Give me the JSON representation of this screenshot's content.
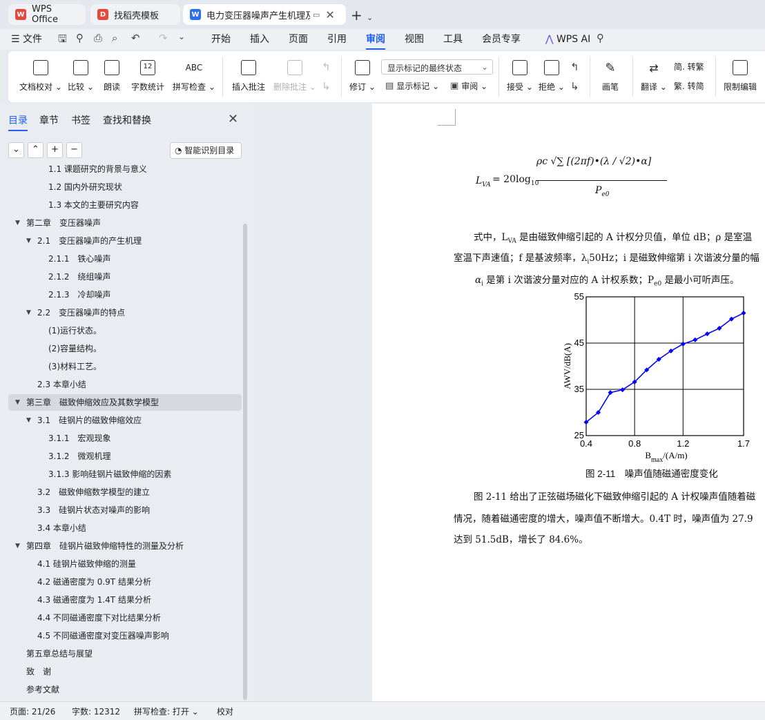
{
  "tabs": [
    {
      "label": "WPS Office",
      "logo": "W",
      "logo_color": "#e8473c"
    },
    {
      "label": "找稻壳模板",
      "logo": "D",
      "logo_color": "#e8473c"
    },
    {
      "label": "电力变压器噪声产生机理及其影",
      "logo": "W",
      "logo_color": "#2d6cf5"
    }
  ],
  "menu": {
    "file": "文件",
    "items": [
      "开始",
      "插入",
      "页面",
      "引用",
      "审阅",
      "视图",
      "工具",
      "会员专享"
    ],
    "active": "审阅",
    "ai": "WPS AI"
  },
  "ribbon": {
    "doc_check": "文档校对",
    "compare": "比较",
    "read": "朗读",
    "word_count": "字数统计",
    "spell": "拼写检查",
    "insert_comment": "插入批注",
    "delete_comment": "删除批注",
    "revise": "修订",
    "show_state": "显示标记的最终状态",
    "show_marks": "显示标记",
    "review": "审阅",
    "accept": "接受",
    "reject": "拒绝",
    "pen": "画笔",
    "translate": "翻译",
    "trad": "简. 转繁",
    "simp": "繁. 转简",
    "restrict": "限制编辑"
  },
  "sidebar": {
    "tabs": [
      "目录",
      "章节",
      "书签",
      "查找和替换"
    ],
    "smart_btn": "智能识别目录",
    "toc": [
      {
        "label": "1.1 课题研究的背景与意义",
        "level": 3
      },
      {
        "label": "1.2 国内外研究现状",
        "level": 3
      },
      {
        "label": "1.3 本文的主要研究内容",
        "level": 3
      },
      {
        "label": "第二章　变压器噪声",
        "level": 1,
        "toggle": true
      },
      {
        "label": "2.1　变压器噪声的产生机理",
        "level": 2,
        "toggle": true
      },
      {
        "label": "2.1.1　铁心噪声",
        "level": 3
      },
      {
        "label": "2.1.2　绕组噪声",
        "level": 3
      },
      {
        "label": "2.1.3　冷却噪声",
        "level": 3
      },
      {
        "label": "2.2　变压器噪声的特点",
        "level": 2,
        "toggle": true
      },
      {
        "label": "(1)运行状态。",
        "level": 3
      },
      {
        "label": "(2)容量结构。",
        "level": 3
      },
      {
        "label": "(3)材料工艺。",
        "level": 3
      },
      {
        "label": "2.3 本章小结",
        "level": 2
      },
      {
        "label": "第三章　磁致伸缩效应及其数学模型",
        "level": 1,
        "toggle": true,
        "selected": true
      },
      {
        "label": "3.1　硅钢片的磁致伸缩效应",
        "level": 2,
        "toggle": true
      },
      {
        "label": "3.1.1　宏观现象",
        "level": 3
      },
      {
        "label": "3.1.2　微观机理",
        "level": 3
      },
      {
        "label": "3.1.3 影响硅钢片磁致伸缩的因素",
        "level": 3
      },
      {
        "label": "3.2　磁致伸缩数学模型的建立",
        "level": 2
      },
      {
        "label": "3.3　硅钢片状态对噪声的影响",
        "level": 2
      },
      {
        "label": "3.4 本章小结",
        "level": 2
      },
      {
        "label": "第四章　硅钢片磁致伸缩特性的测量及分析",
        "level": 1,
        "toggle": true
      },
      {
        "label": "4.1 硅钢片磁致伸缩的测量",
        "level": 2
      },
      {
        "label": "4.2 磁通密度为 0.9T 结果分析",
        "level": 2
      },
      {
        "label": "4.3 磁通密度为 1.4T 结果分析",
        "level": 2
      },
      {
        "label": "4.4 不同磁通密度下对比结果分析",
        "level": 2
      },
      {
        "label": "4.5 不同磁通密度对变压器噪声影响",
        "level": 2
      },
      {
        "label": "第五章总结与展望",
        "level": 1
      },
      {
        "label": "致　谢",
        "level": 1
      },
      {
        "label": "参考文献",
        "level": 1
      }
    ]
  },
  "document": {
    "formula_lhs": "L",
    "formula_lhs_sub": "VA",
    "formula_eq": "= 20log",
    "formula_log_sub": "10",
    "formula_num": "ρc √∑ [(2πf)•(λ / √2)•α]",
    "formula_den": "P",
    "formula_den_sub": "e0",
    "para1": [
      "式中，L",
      "VA",
      " 是由磁致伸缩引起的 A 计权分贝值，单位 dB；ρ 是室温",
      "室温下声速值；f 是基波频率，λ",
      "i",
      "50Hz；i 是磁致伸缩第 i 次谐波分量的幅",
      "α",
      "i",
      " 是第 i 次谐波分量对应的 A 计权系数；P",
      "e0",
      " 是最小可听声压。"
    ],
    "caption": "图 2-11　噪声值随磁通密度变化",
    "para2": [
      "图 2-11 给出了正弦磁场磁化下磁致伸缩引起的 A 计权噪声值随着磁",
      "情况，随着磁通密度的增大，噪声值不断增大。0.4T 时，噪声值为 27.9",
      "达到 51.5dB，增长了 84.6%。"
    ]
  },
  "chart_data": {
    "type": "line",
    "xlabel": "B",
    "xlabel_sub": "max",
    "xlabel_unit": "/(A/m)",
    "ylabel": "AWV/dB(A)",
    "xlim": [
      0.4,
      1.7
    ],
    "ylim": [
      25,
      55
    ],
    "xticks": [
      "0.4",
      "0.8",
      "1.2",
      "1.7"
    ],
    "yticks": [
      "25",
      "35",
      "45",
      "55"
    ],
    "series": [
      {
        "x": [
          0.4,
          0.5,
          0.6,
          0.7,
          0.8,
          0.9,
          1.0,
          1.1,
          1.2,
          1.3,
          1.4,
          1.5,
          1.6,
          1.7
        ],
        "y": [
          27.9,
          30.0,
          34.3,
          34.9,
          36.6,
          39.2,
          41.5,
          43.3,
          44.8,
          45.7,
          47.0,
          48.2,
          50.2,
          51.5
        ],
        "color": "#0000ff"
      }
    ]
  },
  "status": {
    "page": "页面: 21/26",
    "words": "字数: 12312",
    "spell": "拼写检查: 打开",
    "proof": "校对"
  }
}
